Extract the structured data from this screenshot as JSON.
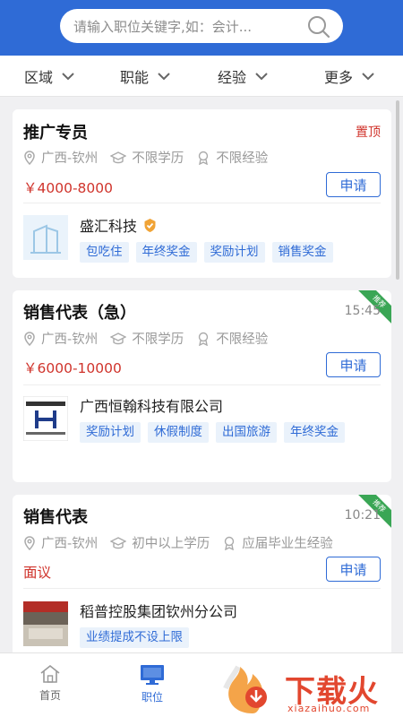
{
  "search": {
    "placeholder": "请输入职位关键字,如：会计..."
  },
  "filters": [
    "区域",
    "职能",
    "经验",
    "更多"
  ],
  "jobs": [
    {
      "title": "推广专员",
      "badge": "置顶",
      "location": "广西-钦州",
      "education": "不限学历",
      "experience": "不限经验",
      "salary": "￥4000-8000",
      "apply": "申请",
      "company": "盛汇科技",
      "tags": [
        "包吃住",
        "年终奖金",
        "奖励计划",
        "销售奖金"
      ]
    },
    {
      "title": "销售代表（急）",
      "time": "15:45",
      "ribbon": "推荐",
      "location": "广西-钦州",
      "education": "不限学历",
      "experience": "不限经验",
      "salary": "￥6000-10000",
      "apply": "申请",
      "company": "广西恒翰科技有限公司",
      "tags": [
        "奖励计划",
        "休假制度",
        "出国旅游",
        "年终奖金"
      ]
    },
    {
      "title": "销售代表",
      "time": "10:21",
      "ribbon": "推荐",
      "location": "广西-钦州",
      "education": "初中以上学历",
      "experience": "应届毕业生经验",
      "salary": "面议",
      "apply": "申请",
      "company": "稻普控股集团钦州分公司",
      "tags": [
        "业绩提成不设上限"
      ]
    }
  ],
  "tabs": [
    {
      "label": "首页",
      "active": false
    },
    {
      "label": "职位",
      "active": true
    }
  ],
  "watermark": {
    "text": "下载火",
    "sub": "xiazaihuo.com"
  },
  "colors": {
    "primary": "#2f6bd6",
    "salary": "#d0342c",
    "ribbon": "#3aa655"
  }
}
